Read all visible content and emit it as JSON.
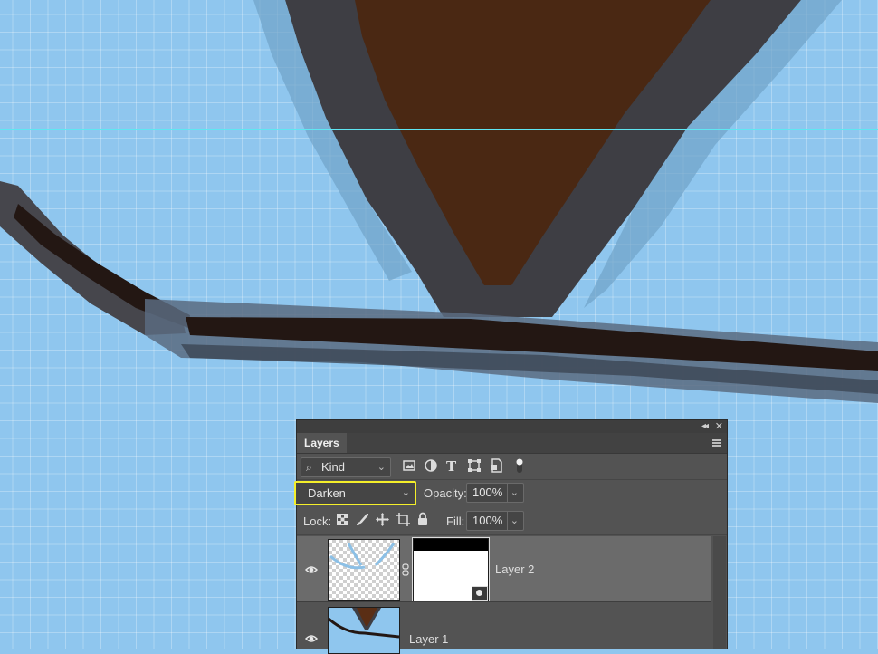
{
  "panel": {
    "tab_title": "Layers",
    "collapse_icon": "double-chevron-left-icon",
    "close_icon": "close-icon",
    "menu_icon": "panel-menu-icon"
  },
  "filter": {
    "kind_label": "Kind",
    "icons": [
      "image-filter-icon",
      "adjustment-filter-icon",
      "type-filter-icon",
      "shape-filter-icon",
      "smart-object-filter-icon",
      "filter-toggle-icon"
    ]
  },
  "blend": {
    "mode": "Darken",
    "opacity_label": "Opacity:",
    "opacity_value": "100%"
  },
  "lock": {
    "label": "Lock:",
    "icons": [
      "lock-transparent-pixels-icon",
      "lock-image-pixels-icon",
      "lock-position-icon",
      "lock-artboard-icon",
      "lock-all-icon"
    ],
    "fill_label": "Fill:",
    "fill_value": "100%"
  },
  "layers": [
    {
      "name": "Layer 2",
      "selected": true,
      "visible": true,
      "has_mask": true
    },
    {
      "name": "Layer 1",
      "selected": false,
      "visible": true,
      "has_mask": false
    }
  ],
  "colors": {
    "canvas_bg": "#8fc6ee",
    "brown_fill": "#4a2813",
    "dark_outline": "#231713",
    "panel_bg": "#535353",
    "selected_row": "#6b6b6b",
    "highlight_box": "#f4ef2a"
  }
}
